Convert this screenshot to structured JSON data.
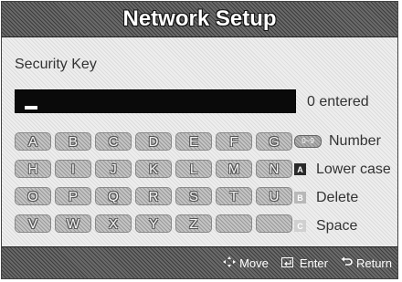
{
  "dialog": {
    "title": "Network Setup"
  },
  "security": {
    "label": "Security Key",
    "entered": "0 entered"
  },
  "keyboard": {
    "keys": [
      "A",
      "B",
      "C",
      "D",
      "E",
      "F",
      "G",
      "H",
      "I",
      "J",
      "K",
      "L",
      "M",
      "N",
      "O",
      "P",
      "Q",
      "R",
      "S",
      "T",
      "U",
      "V",
      "W",
      "X",
      "Y",
      "Z",
      "",
      ""
    ]
  },
  "legend": {
    "number_label": "Number",
    "number_badge": "0~9",
    "lower_badge": "A",
    "lower_label": "Lower case",
    "delete_badge": "B",
    "delete_label": "Delete",
    "space_badge": "C",
    "space_label": "Space"
  },
  "footer": {
    "move_label": "Move",
    "enter_label": "Enter",
    "return_label": "Return"
  }
}
